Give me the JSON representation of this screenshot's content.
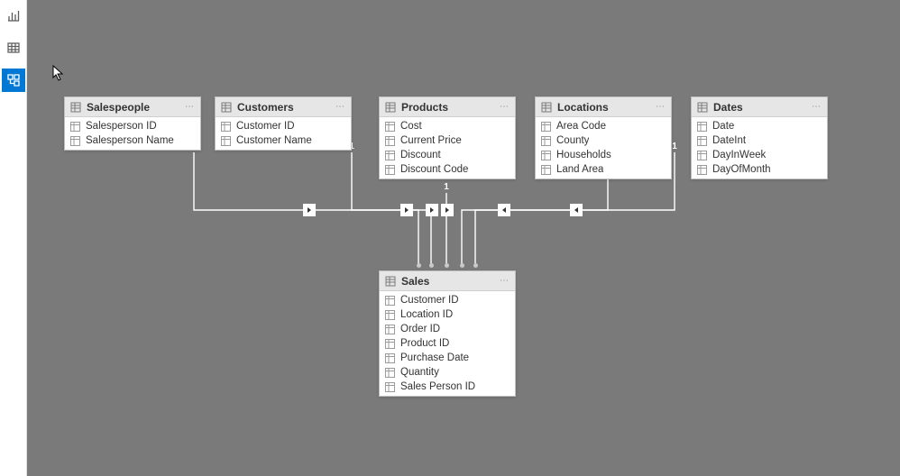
{
  "sidebar": {
    "report_tooltip": "Report",
    "data_tooltip": "Data",
    "model_tooltip": "Model"
  },
  "entities": {
    "salespeople": {
      "title": "Salespeople",
      "fields": [
        "Salesperson ID",
        "Salesperson Name"
      ]
    },
    "customers": {
      "title": "Customers",
      "fields": [
        "Customer ID",
        "Customer Name"
      ]
    },
    "products": {
      "title": "Products",
      "fields": [
        "Cost",
        "Current Price",
        "Discount",
        "Discount Code"
      ]
    },
    "locations": {
      "title": "Locations",
      "fields": [
        "Area Code",
        "County",
        "Households",
        "Land Area"
      ]
    },
    "dates": {
      "title": "Dates",
      "fields": [
        "Date",
        "DateInt",
        "DayInWeek",
        "DayOfMonth"
      ]
    },
    "sales": {
      "title": "Sales",
      "fields": [
        "Customer ID",
        "Location ID",
        "Order ID",
        "Product ID",
        "Purchase Date",
        "Quantity",
        "Sales Person ID"
      ]
    }
  },
  "cardinality": {
    "one": "1",
    "many": "*"
  }
}
